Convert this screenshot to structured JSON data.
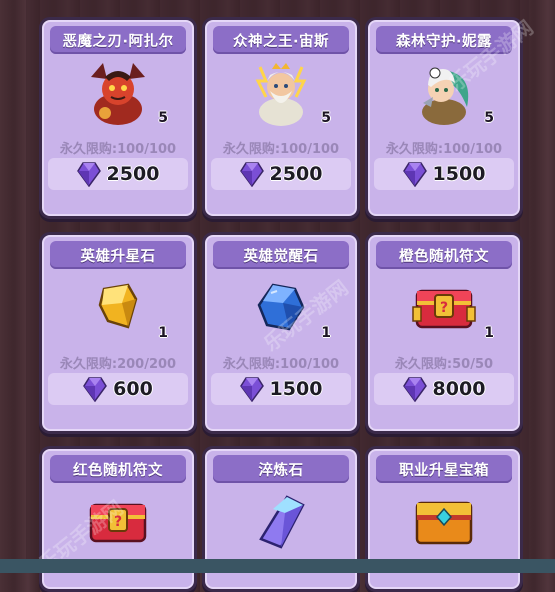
{
  "row1": [
    {
      "title": "恶魔之刃·阿扎尔",
      "qty": "5",
      "limit": "永久限购:100/100",
      "price": "2500",
      "icon": "demon-hero-icon"
    },
    {
      "title": "众神之王·宙斯",
      "qty": "5",
      "limit": "永久限购:100/100",
      "price": "2500",
      "icon": "zeus-hero-icon"
    },
    {
      "title": "森林守护·妮露",
      "qty": "5",
      "limit": "永久限购:100/100",
      "price": "1500",
      "icon": "forest-hero-icon"
    }
  ],
  "row2": [
    {
      "title": "英雄升星石",
      "qty": "1",
      "limit": "永久限购:200/200",
      "price": "600",
      "icon": "gold-star-stone-icon"
    },
    {
      "title": "英雄觉醒石",
      "qty": "1",
      "limit": "永久限购:100/100",
      "price": "1500",
      "icon": "blue-awaken-stone-icon"
    },
    {
      "title": "橙色随机符文",
      "qty": "1",
      "limit": "永久限购:50/50",
      "price": "8000",
      "icon": "red-rune-chest-icon"
    }
  ],
  "row3": [
    {
      "title": "红色随机符文",
      "icon": "red-rune-chest-icon"
    },
    {
      "title": "淬炼石",
      "icon": "crystal-icon"
    },
    {
      "title": "职业升星宝箱",
      "icon": "gold-treasure-chest-icon"
    }
  ],
  "watermark": "乐玩手游网",
  "colors": {
    "card": "#c9b3ea",
    "title_bar": "#8c6ec7",
    "gem": "#7b4fd6"
  }
}
